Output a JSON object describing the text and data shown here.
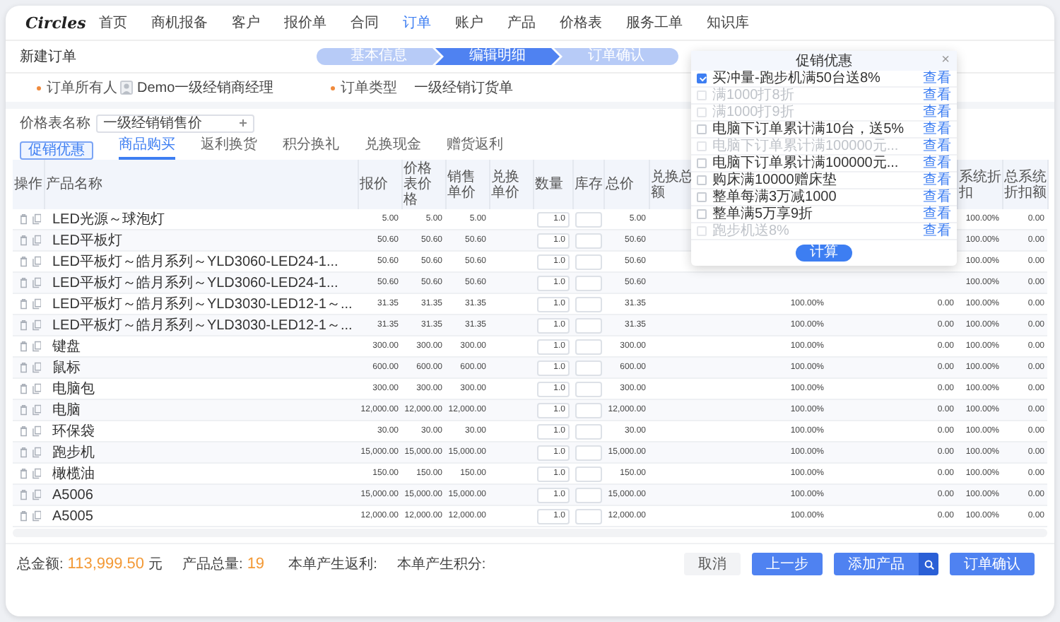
{
  "nav": {
    "logo": "Circles",
    "items": [
      {
        "label": "首页",
        "selected": false
      },
      {
        "label": "商机报备",
        "selected": false
      },
      {
        "label": "客户",
        "selected": false
      },
      {
        "label": "报价单",
        "selected": false
      },
      {
        "label": "合同",
        "selected": false
      },
      {
        "label": "订单",
        "selected": true
      },
      {
        "label": "账户",
        "selected": false
      },
      {
        "label": "产品",
        "selected": false
      },
      {
        "label": "价格表",
        "selected": false
      },
      {
        "label": "服务工单",
        "selected": false
      },
      {
        "label": "知识库",
        "selected": false
      }
    ]
  },
  "page_title": "新建订单",
  "steps": [
    {
      "label": "基本信息",
      "selected": false
    },
    {
      "label": "编辑明细",
      "selected": true
    },
    {
      "label": "订单确认",
      "selected": false
    }
  ],
  "owner": {
    "label": "订单所有人",
    "required": true,
    "value": "Demo一级经销商经理"
  },
  "order_type": {
    "label": "订单类型",
    "required": true,
    "value": "一级经销订货单"
  },
  "price_list": {
    "label": "价格表名称",
    "value": "一级经销销售价"
  },
  "promo_button": "促销优惠",
  "tabs": [
    {
      "label": "商品购买",
      "selected": true
    },
    {
      "label": "返利换货",
      "selected": false
    },
    {
      "label": "积分换礼",
      "selected": false
    },
    {
      "label": "兑换现金",
      "selected": false
    },
    {
      "label": "赠货返利",
      "selected": false
    }
  ],
  "table": {
    "columns": {
      "action": "操作",
      "name": "产品名称",
      "quote": "报价",
      "list_price": "价格表价格",
      "sale_price": "销售单价",
      "exchange_price": "兑换单价",
      "quantity": "数量",
      "stock": "库存",
      "total": "总价",
      "exchange_total": "兑换总额",
      "system_discount": "系统折扣",
      "system_discount_amount": "总系统折扣额"
    },
    "rows": [
      {
        "name": "LED光源～球泡灯",
        "quote": "5.00",
        "list_price": "5.00",
        "sale_price": "5.00",
        "quantity": "1.0",
        "total": "5.00",
        "system_discount": "100.00%",
        "system_discount_amount": "0.00"
      },
      {
        "name": "LED平板灯",
        "quote": "50.60",
        "list_price": "50.60",
        "sale_price": "50.60",
        "quantity": "1.0",
        "total": "50.60",
        "system_discount": "100.00%",
        "system_discount_amount": "0.00"
      },
      {
        "name": "LED平板灯～皓月系列～YLD3060-LED24-1...",
        "quote": "50.60",
        "list_price": "50.60",
        "sale_price": "50.60",
        "quantity": "1.0",
        "total": "50.60",
        "system_discount": "100.00%",
        "system_discount_amount": "0.00"
      },
      {
        "name": "LED平板灯～皓月系列～YLD3060-LED24-1...",
        "quote": "50.60",
        "list_price": "50.60",
        "sale_price": "50.60",
        "quantity": "1.0",
        "total": "50.60",
        "system_discount": "100.00%",
        "system_discount_amount": "0.00"
      },
      {
        "name": "LED平板灯～皓月系列～YLD3030-LED12-1～...",
        "quote": "31.35",
        "list_price": "31.35",
        "sale_price": "31.35",
        "quantity": "1.0",
        "total": "31.35",
        "column_11": "100.00%",
        "column_12": "0.00",
        "system_discount": "100.00%",
        "system_discount_amount": "0.00"
      },
      {
        "name": "LED平板灯～皓月系列～YLD3030-LED12-1～...",
        "quote": "31.35",
        "list_price": "31.35",
        "sale_price": "31.35",
        "quantity": "1.0",
        "total": "31.35",
        "column_11": "100.00%",
        "column_12": "0.00",
        "system_discount": "100.00%",
        "system_discount_amount": "0.00"
      },
      {
        "name": "键盘",
        "quote": "300.00",
        "list_price": "300.00",
        "sale_price": "300.00",
        "quantity": "1.0",
        "total": "300.00",
        "column_11": "100.00%",
        "column_12": "0.00",
        "system_discount": "100.00%",
        "system_discount_amount": "0.00"
      },
      {
        "name": "鼠标",
        "quote": "600.00",
        "list_price": "600.00",
        "sale_price": "600.00",
        "quantity": "1.0",
        "total": "600.00",
        "column_11": "100.00%",
        "column_12": "0.00",
        "system_discount": "100.00%",
        "system_discount_amount": "0.00"
      },
      {
        "name": "电脑包",
        "quote": "300.00",
        "list_price": "300.00",
        "sale_price": "300.00",
        "quantity": "1.0",
        "total": "300.00",
        "column_11": "100.00%",
        "column_12": "0.00",
        "system_discount": "100.00%",
        "system_discount_amount": "0.00"
      },
      {
        "name": "电脑",
        "quote": "12,000.00",
        "list_price": "12,000.00",
        "sale_price": "12,000.00",
        "quantity": "1.0",
        "total": "12,000.00",
        "column_11": "100.00%",
        "column_12": "0.00",
        "system_discount": "100.00%",
        "system_discount_amount": "0.00"
      },
      {
        "name": "环保袋",
        "quote": "30.00",
        "list_price": "30.00",
        "sale_price": "30.00",
        "quantity": "1.0",
        "total": "30.00",
        "column_11": "100.00%",
        "column_12": "0.00",
        "system_discount": "100.00%",
        "system_discount_amount": "0.00"
      },
      {
        "name": "跑步机",
        "quote": "15,000.00",
        "list_price": "15,000.00",
        "sale_price": "15,000.00",
        "quantity": "1.0",
        "total": "15,000.00",
        "column_11": "100.00%",
        "column_12": "0.00",
        "system_discount": "100.00%",
        "system_discount_amount": "0.00"
      },
      {
        "name": "橄榄油",
        "quote": "150.00",
        "list_price": "150.00",
        "sale_price": "150.00",
        "quantity": "1.0",
        "total": "150.00",
        "column_11": "100.00%",
        "column_12": "0.00",
        "system_discount": "100.00%",
        "system_discount_amount": "0.00"
      },
      {
        "name": "A5006",
        "quote": "15,000.00",
        "list_price": "15,000.00",
        "sale_price": "15,000.00",
        "quantity": "1.0",
        "total": "15,000.00",
        "column_11": "100.00%",
        "column_12": "0.00",
        "system_discount": "100.00%",
        "system_discount_amount": "0.00"
      },
      {
        "name": "A5005",
        "quote": "12,000.00",
        "list_price": "12,000.00",
        "sale_price": "12,000.00",
        "quantity": "1.0",
        "total": "12,000.00",
        "column_11": "100.00%",
        "column_12": "0.00",
        "system_discount": "100.00%",
        "system_discount_amount": "0.00"
      }
    ]
  },
  "promo": {
    "title": "促销优惠",
    "close": "×",
    "button": "计算",
    "items": [
      {
        "label": "买冲量-跑步机满50台送8%",
        "checked": true,
        "disabled": false,
        "link": "查看"
      },
      {
        "label": "满1000打8折",
        "checked": false,
        "disabled": true,
        "link": "查看"
      },
      {
        "label": "满1000打9折",
        "checked": false,
        "disabled": true,
        "link": "查看"
      },
      {
        "label": "电脑下订单累计满10台，送5%",
        "checked": false,
        "disabled": false,
        "link": "查看"
      },
      {
        "label": "电脑下订单累计满100000元...",
        "checked": false,
        "disabled": true,
        "link": "查看"
      },
      {
        "label": "电脑下订单累计满100000元...",
        "checked": false,
        "disabled": false,
        "link": "查看"
      },
      {
        "label": "购床满10000赠床垫",
        "checked": false,
        "disabled": false,
        "link": "查看"
      },
      {
        "label": "整单每满3万减1000",
        "checked": false,
        "disabled": false,
        "link": "查看"
      },
      {
        "label": "整单满5万享9折",
        "checked": false,
        "disabled": false,
        "link": "查看"
      },
      {
        "label": "跑步机送8%",
        "checked": false,
        "disabled": true,
        "link": "查看"
      }
    ]
  },
  "footer": {
    "total_label": "总金额:",
    "total": "113,999.50",
    "currency": "元",
    "quantity_label": "产品总量:",
    "quantity": "19",
    "rebate_label": "本单产生返利:",
    "points_label": "本单产生积分:",
    "buttons": [
      {
        "label": "取消",
        "kind": "secondary"
      },
      {
        "label": "上一步",
        "kind": "primary"
      },
      {
        "label": "添加产品",
        "kind": "search"
      },
      {
        "label": "订单确认",
        "kind": "primary"
      }
    ]
  }
}
